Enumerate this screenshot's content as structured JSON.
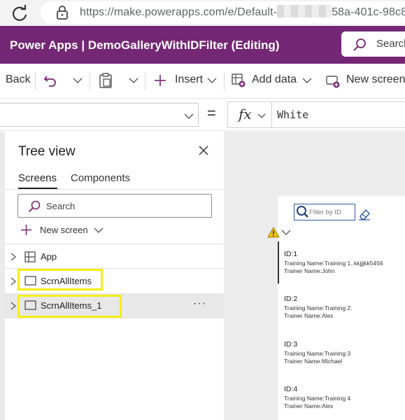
{
  "browser": {
    "url_prefix": "https://make.powerapps.com/e/Default-",
    "url_suffix": "58a-401c-98c8-"
  },
  "app_header": {
    "title": "Power Apps  |  DemoGalleryWithIDFilter (Editing)",
    "search_label": "Search",
    "brand_color": "#742774"
  },
  "command_bar": {
    "back": "Back",
    "insert": "Insert",
    "add_data": "Add data",
    "new_screen": "New screen"
  },
  "formula_bar": {
    "equals": "=",
    "fx": "fx",
    "formula": "White"
  },
  "tree_view": {
    "title": "Tree view",
    "tabs": [
      "Screens",
      "Components"
    ],
    "search_placeholder": "Search",
    "new_screen": "New screen",
    "items": [
      {
        "label": "App",
        "icon": "app-icon"
      },
      {
        "label": "ScrnAllItems",
        "icon": "screen-icon"
      },
      {
        "label": "ScrnAllItems_1",
        "icon": "screen-icon"
      }
    ],
    "more": "···"
  },
  "canvas": {
    "filter_placeholder": "Filter by ID",
    "gallery": [
      {
        "id": "ID:1",
        "training": "Training Name:Training 1..kkjjjkk5456",
        "trainer": "Trainer Name:John"
      },
      {
        "id": "ID:2",
        "training": "Training Name:Training 2.",
        "trainer": "Trainer Name:Alex"
      },
      {
        "id": "ID:3",
        "training": "Training Name:Training 3",
        "trainer": "Trainer Name:Michael"
      },
      {
        "id": "ID:4",
        "training": "Training Name:Training 4",
        "trainer": "Trainer Name:Alex"
      }
    ]
  }
}
